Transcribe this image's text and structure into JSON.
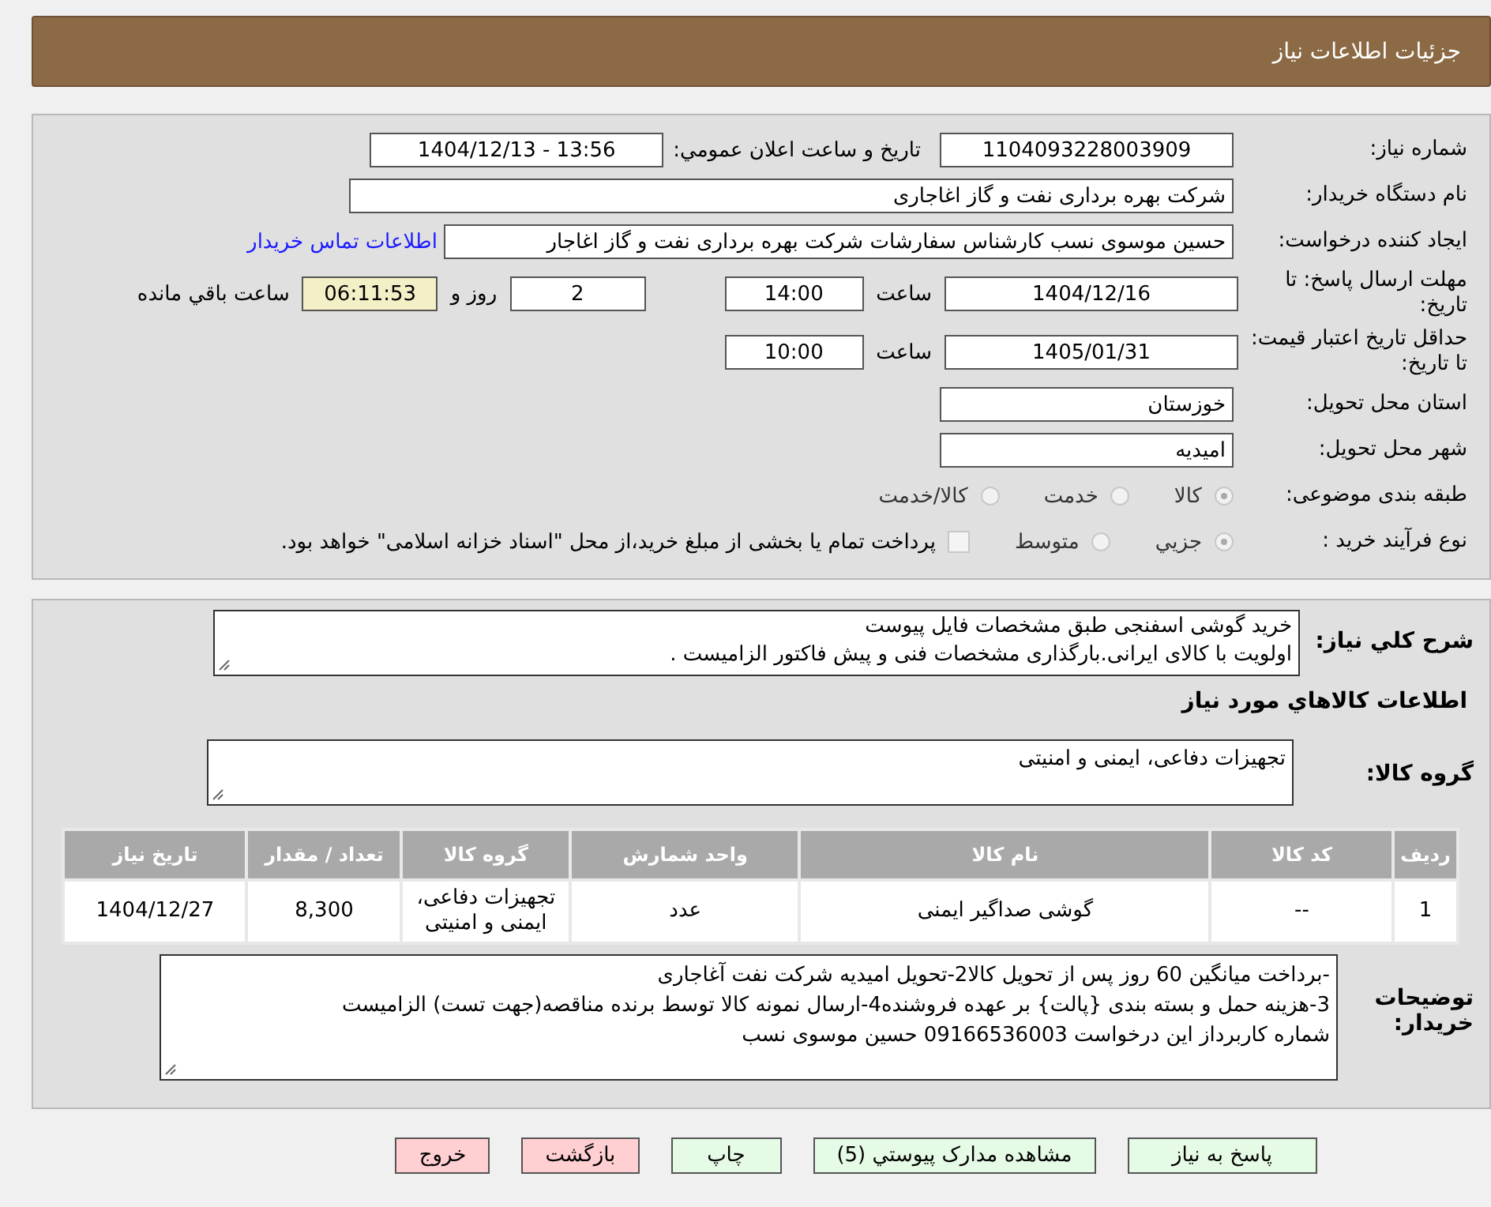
{
  "header": {
    "title": "جزئیات اطلاعات نیاز"
  },
  "need_number": {
    "label": "شماره نیاز:",
    "value": "1104093228003909"
  },
  "announce": {
    "label": "تاریخ و ساعت اعلان عمومي:",
    "value": "1404/12/13 - 13:56"
  },
  "buyer_org": {
    "label": "نام دستگاه خریدار:",
    "value": "شرکت بهره برداری نفت و گاز اغاجاری"
  },
  "creator": {
    "label": "ایجاد کننده درخواست:",
    "value": "حسین موسوی نسب کارشناس سفارشات شرکت بهره برداری نفت و گاز اغاجار",
    "link": "اطلاعات تماس خریدار"
  },
  "deadline": {
    "label": "مهلت ارسال پاسخ: تا تاریخ:",
    "date": "1404/12/16",
    "time_label": "ساعت",
    "time": "14:00",
    "days": "2",
    "days_label": "روز و",
    "remaining": "06:11:53",
    "remaining_label": "ساعت باقي مانده"
  },
  "validity": {
    "label": "حداقل تاریخ اعتبار قیمت: تا تاریخ:",
    "date": "1405/01/31",
    "time_label": "ساعت",
    "time": "10:00"
  },
  "province": {
    "label": "استان محل تحویل:",
    "value": "خوزستان"
  },
  "city": {
    "label": "شهر محل تحویل:",
    "value": "امیدیه"
  },
  "category": {
    "label": "طبقه بندی موضوعی:",
    "options": [
      {
        "label": "کالا",
        "selected": true
      },
      {
        "label": "خدمت",
        "selected": false
      },
      {
        "label": "کالا/خدمت",
        "selected": false
      }
    ]
  },
  "process": {
    "label": "نوع فرآیند خرید :",
    "options": [
      {
        "label": "جزيي",
        "selected": true
      },
      {
        "label": "متوسط",
        "selected": false
      }
    ],
    "treasury": {
      "label": "پرداخت تمام یا بخشی از مبلغ خرید،از محل \"اسناد خزانه اسلامی\" خواهد بود.",
      "checked": false
    }
  },
  "summary": {
    "label": "شرح کلي نیاز:",
    "value": "خرید گوشی اسفنجی  طبق مشخصات فایل پیوست\nاولویت با کالای ایرانی.بارگذاری مشخصات فنی و پیش فاکتور الزامیست ."
  },
  "goods_heading": "اطلاعات کالاهاي مورد نیاز",
  "goods_group": {
    "label": "گروه کالا:",
    "value": "تجهیزات دفاعی، ایمنی و امنیتی"
  },
  "table": {
    "columns": [
      "رديف",
      "کد کالا",
      "نام کالا",
      "واحد شمارش",
      "گروه کالا",
      "تعداد / مقدار",
      "تاریخ نیاز"
    ],
    "rows": [
      [
        "1",
        "--",
        "گوشی صداگیر ایمنی",
        "عدد",
        "تجهیزات دفاعی، ایمنی و امنیتی",
        "8,300",
        "1404/12/27"
      ]
    ]
  },
  "notes": {
    "label": "توضیحات خریدار:",
    "value": "-برداخت میانگین 60 روز پس از تحویل کالا2-تحویل امیدیه شرکت نفت آغاجاری\n3-هزینه حمل  و بسته بندی {پالت} بر عهده فروشنده4-ارسال نمونه کالا توسط برنده مناقصه(جهت تست) الزامیست\nشماره کاربرداز این درخواست 09166536003 حسین موسوی نسب"
  },
  "buttons": [
    {
      "label": "پاسخ به نیاز",
      "kind": "action"
    },
    {
      "label": "مشاهده مدارک پیوستي (5)",
      "kind": "action"
    },
    {
      "label": "چاپ",
      "kind": "action"
    },
    {
      "label": "بازگشت",
      "kind": "exit"
    },
    {
      "label": "خروج",
      "kind": "exit"
    }
  ]
}
